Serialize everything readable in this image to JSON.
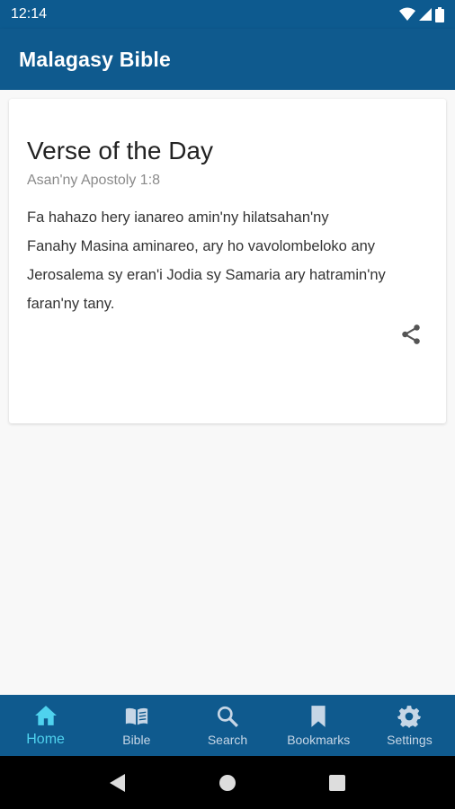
{
  "status_bar": {
    "time": "12:14"
  },
  "app_bar": {
    "title": "Malagasy Bible"
  },
  "verse_card": {
    "title": "Verse of the Day",
    "reference": "Asan'ny Apostoly 1:8",
    "lines": [
      "Fa hahazo hery ianareo amin'ny hilatsahan'ny",
      "Fanahy Masina aminareo, ary ho vavolombeloko any",
      "Jerosalema sy eran'i Jodia sy Samaria ary hatramin'ny",
      "faran'ny tany."
    ]
  },
  "bottom_nav": {
    "items": [
      {
        "label": "Home",
        "icon": "home-icon",
        "active": true
      },
      {
        "label": "Bible",
        "icon": "book-icon",
        "active": false
      },
      {
        "label": "Search",
        "icon": "search-icon",
        "active": false
      },
      {
        "label": "Bookmarks",
        "icon": "bookmark-icon",
        "active": false
      },
      {
        "label": "Settings",
        "icon": "gear-icon",
        "active": false
      }
    ]
  },
  "colors": {
    "primary": "#0f5a8e",
    "accent": "#4fd2ee",
    "inactive_nav": "#c6d6e6"
  }
}
